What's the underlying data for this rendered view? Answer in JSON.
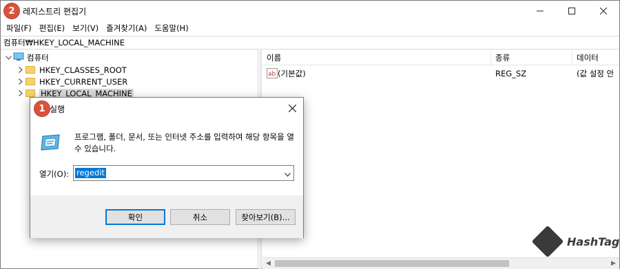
{
  "window": {
    "title": "레지스트리 편집기",
    "badge_main": "2",
    "controls": {
      "minimize": "—",
      "maximize": "☐",
      "close": "✕"
    }
  },
  "menu": [
    "파일(F)",
    "편집(E)",
    "보기(V)",
    "즐겨찾기(A)",
    "도움말(H)"
  ],
  "address": "컴퓨터₩HKEY_LOCAL_MACHINE",
  "tree": {
    "root_label": "컴퓨터",
    "items": [
      {
        "label": "HKEY_CLASSES_ROOT"
      },
      {
        "label": "HKEY_CURRENT_USER"
      },
      {
        "label": "HKEY_LOCAL_MACHINE",
        "selected": true
      }
    ]
  },
  "list": {
    "headers": [
      "이름",
      "종류",
      "데이터"
    ],
    "rows": [
      {
        "name": "(기본값)",
        "type": "REG_SZ",
        "data": "(값 설정 안"
      }
    ]
  },
  "watermark": "HashTag",
  "dialog": {
    "title": "실행",
    "badge": "1",
    "description": "프로그램, 폴더, 문서, 또는 인터넷 주소를 입력하여 해당 항목을 열 수 있습니다.",
    "open_label": "열기(O):",
    "input_value": "regedit",
    "buttons": {
      "ok": "확인",
      "cancel": "취소",
      "browse": "찾아보기(B)..."
    }
  }
}
